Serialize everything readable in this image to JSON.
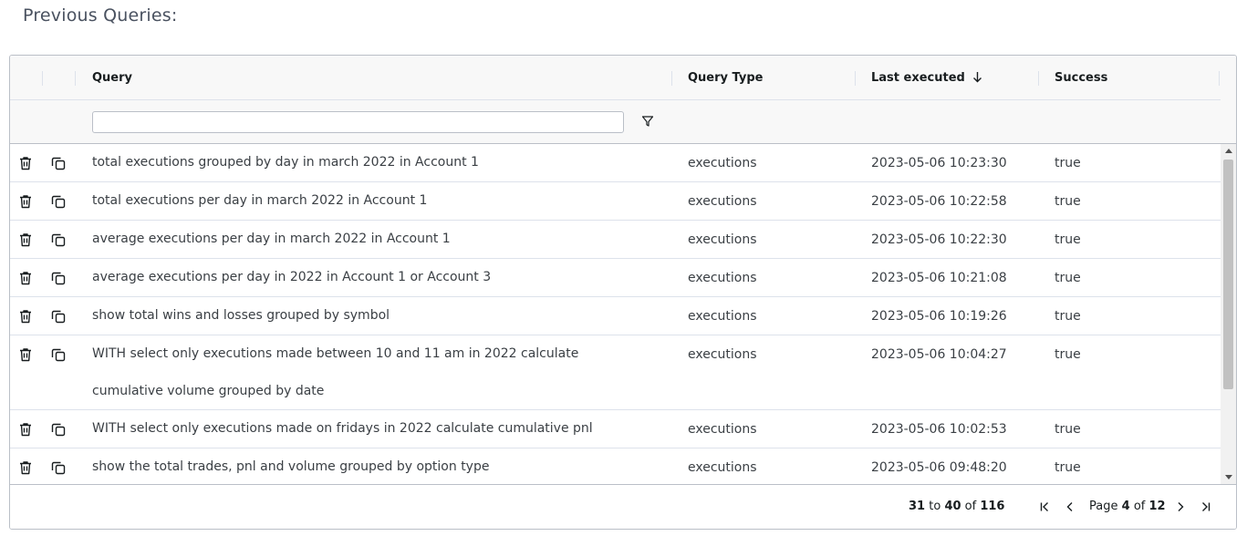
{
  "page_title": "Previous Queries:",
  "grid": {
    "columns": {
      "query": "Query",
      "query_type": "Query Type",
      "last_executed": "Last executed",
      "success": "Success"
    },
    "sort": {
      "column": "last_executed",
      "direction": "desc",
      "icon": "arrow-down-icon"
    },
    "filter": {
      "query_value": "",
      "icon": "filter-icon"
    },
    "row_icons": {
      "delete": "trash-icon",
      "copy": "copy-icon"
    },
    "rows": [
      {
        "query": "total executions grouped by day in march 2022 in Account 1",
        "query_type": "executions",
        "last_executed": "2023-05-06 10:23:30",
        "success": "true"
      },
      {
        "query": "total executions per day in march 2022 in Account 1",
        "query_type": "executions",
        "last_executed": "2023-05-06 10:22:58",
        "success": "true"
      },
      {
        "query": "average executions per day in march 2022 in Account 1",
        "query_type": "executions",
        "last_executed": "2023-05-06 10:22:30",
        "success": "true"
      },
      {
        "query": "average executions per day in 2022 in Account 1 or Account 3",
        "query_type": "executions",
        "last_executed": "2023-05-06 10:21:08",
        "success": "true"
      },
      {
        "query": "show total wins and losses grouped by symbol",
        "query_type": "executions",
        "last_executed": "2023-05-06 10:19:26",
        "success": "true"
      },
      {
        "query": "WITH select only executions made between 10 and 11 am in 2022 calculate cumulative volume grouped by date",
        "query_type": "executions",
        "last_executed": "2023-05-06 10:04:27",
        "success": "true"
      },
      {
        "query": "WITH select only executions made on fridays in 2022 calculate cumulative pnl",
        "query_type": "executions",
        "last_executed": "2023-05-06 10:02:53",
        "success": "true"
      },
      {
        "query": "show the total trades, pnl and volume grouped by option type",
        "query_type": "executions",
        "last_executed": "2023-05-06 09:48:20",
        "success": "true"
      }
    ]
  },
  "pagination": {
    "from": "31",
    "to_word": "to",
    "to": "40",
    "of_word": "of",
    "total": "116",
    "page_word": "Page",
    "page": "4",
    "page_of_word": "of",
    "page_count": "12",
    "icons": [
      "first-page-icon",
      "previous-page-icon",
      "next-page-icon",
      "last-page-icon"
    ]
  }
}
